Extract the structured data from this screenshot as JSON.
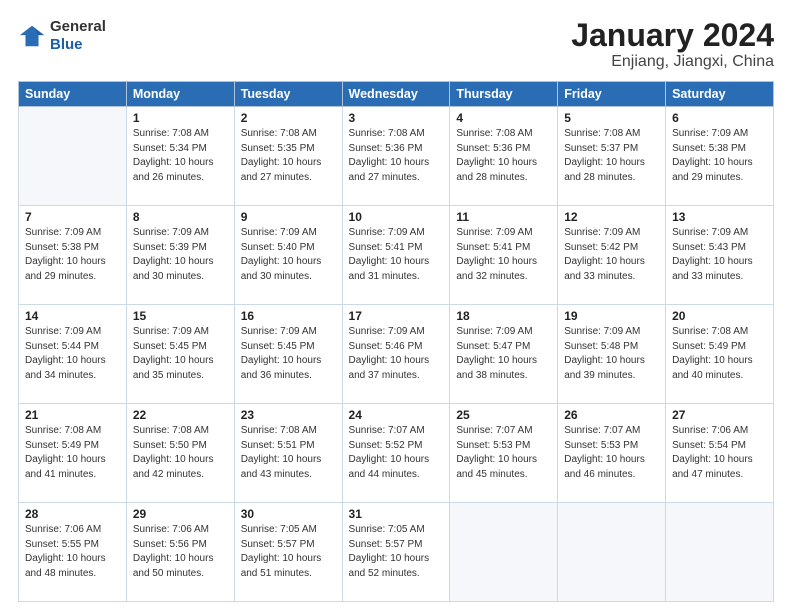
{
  "header": {
    "logo_line1": "General",
    "logo_line2": "Blue",
    "month_title": "January 2024",
    "location": "Enjiang, Jiangxi, China"
  },
  "weekdays": [
    "Sunday",
    "Monday",
    "Tuesday",
    "Wednesday",
    "Thursday",
    "Friday",
    "Saturday"
  ],
  "weeks": [
    [
      {
        "day": "",
        "sunrise": "",
        "sunset": "",
        "daylight": ""
      },
      {
        "day": "1",
        "sunrise": "7:08 AM",
        "sunset": "5:34 PM",
        "daylight": "10 hours and 26 minutes."
      },
      {
        "day": "2",
        "sunrise": "7:08 AM",
        "sunset": "5:35 PM",
        "daylight": "10 hours and 27 minutes."
      },
      {
        "day": "3",
        "sunrise": "7:08 AM",
        "sunset": "5:36 PM",
        "daylight": "10 hours and 27 minutes."
      },
      {
        "day": "4",
        "sunrise": "7:08 AM",
        "sunset": "5:36 PM",
        "daylight": "10 hours and 28 minutes."
      },
      {
        "day": "5",
        "sunrise": "7:08 AM",
        "sunset": "5:37 PM",
        "daylight": "10 hours and 28 minutes."
      },
      {
        "day": "6",
        "sunrise": "7:09 AM",
        "sunset": "5:38 PM",
        "daylight": "10 hours and 29 minutes."
      }
    ],
    [
      {
        "day": "7",
        "sunrise": "7:09 AM",
        "sunset": "5:38 PM",
        "daylight": "10 hours and 29 minutes."
      },
      {
        "day": "8",
        "sunrise": "7:09 AM",
        "sunset": "5:39 PM",
        "daylight": "10 hours and 30 minutes."
      },
      {
        "day": "9",
        "sunrise": "7:09 AM",
        "sunset": "5:40 PM",
        "daylight": "10 hours and 30 minutes."
      },
      {
        "day": "10",
        "sunrise": "7:09 AM",
        "sunset": "5:41 PM",
        "daylight": "10 hours and 31 minutes."
      },
      {
        "day": "11",
        "sunrise": "7:09 AM",
        "sunset": "5:41 PM",
        "daylight": "10 hours and 32 minutes."
      },
      {
        "day": "12",
        "sunrise": "7:09 AM",
        "sunset": "5:42 PM",
        "daylight": "10 hours and 33 minutes."
      },
      {
        "day": "13",
        "sunrise": "7:09 AM",
        "sunset": "5:43 PM",
        "daylight": "10 hours and 33 minutes."
      }
    ],
    [
      {
        "day": "14",
        "sunrise": "7:09 AM",
        "sunset": "5:44 PM",
        "daylight": "10 hours and 34 minutes."
      },
      {
        "day": "15",
        "sunrise": "7:09 AM",
        "sunset": "5:45 PM",
        "daylight": "10 hours and 35 minutes."
      },
      {
        "day": "16",
        "sunrise": "7:09 AM",
        "sunset": "5:45 PM",
        "daylight": "10 hours and 36 minutes."
      },
      {
        "day": "17",
        "sunrise": "7:09 AM",
        "sunset": "5:46 PM",
        "daylight": "10 hours and 37 minutes."
      },
      {
        "day": "18",
        "sunrise": "7:09 AM",
        "sunset": "5:47 PM",
        "daylight": "10 hours and 38 minutes."
      },
      {
        "day": "19",
        "sunrise": "7:09 AM",
        "sunset": "5:48 PM",
        "daylight": "10 hours and 39 minutes."
      },
      {
        "day": "20",
        "sunrise": "7:08 AM",
        "sunset": "5:49 PM",
        "daylight": "10 hours and 40 minutes."
      }
    ],
    [
      {
        "day": "21",
        "sunrise": "7:08 AM",
        "sunset": "5:49 PM",
        "daylight": "10 hours and 41 minutes."
      },
      {
        "day": "22",
        "sunrise": "7:08 AM",
        "sunset": "5:50 PM",
        "daylight": "10 hours and 42 minutes."
      },
      {
        "day": "23",
        "sunrise": "7:08 AM",
        "sunset": "5:51 PM",
        "daylight": "10 hours and 43 minutes."
      },
      {
        "day": "24",
        "sunrise": "7:07 AM",
        "sunset": "5:52 PM",
        "daylight": "10 hours and 44 minutes."
      },
      {
        "day": "25",
        "sunrise": "7:07 AM",
        "sunset": "5:53 PM",
        "daylight": "10 hours and 45 minutes."
      },
      {
        "day": "26",
        "sunrise": "7:07 AM",
        "sunset": "5:53 PM",
        "daylight": "10 hours and 46 minutes."
      },
      {
        "day": "27",
        "sunrise": "7:06 AM",
        "sunset": "5:54 PM",
        "daylight": "10 hours and 47 minutes."
      }
    ],
    [
      {
        "day": "28",
        "sunrise": "7:06 AM",
        "sunset": "5:55 PM",
        "daylight": "10 hours and 48 minutes."
      },
      {
        "day": "29",
        "sunrise": "7:06 AM",
        "sunset": "5:56 PM",
        "daylight": "10 hours and 50 minutes."
      },
      {
        "day": "30",
        "sunrise": "7:05 AM",
        "sunset": "5:57 PM",
        "daylight": "10 hours and 51 minutes."
      },
      {
        "day": "31",
        "sunrise": "7:05 AM",
        "sunset": "5:57 PM",
        "daylight": "10 hours and 52 minutes."
      },
      {
        "day": "",
        "sunrise": "",
        "sunset": "",
        "daylight": ""
      },
      {
        "day": "",
        "sunrise": "",
        "sunset": "",
        "daylight": ""
      },
      {
        "day": "",
        "sunrise": "",
        "sunset": "",
        "daylight": ""
      }
    ]
  ],
  "labels": {
    "sunrise": "Sunrise:",
    "sunset": "Sunset:",
    "daylight": "Daylight:"
  }
}
